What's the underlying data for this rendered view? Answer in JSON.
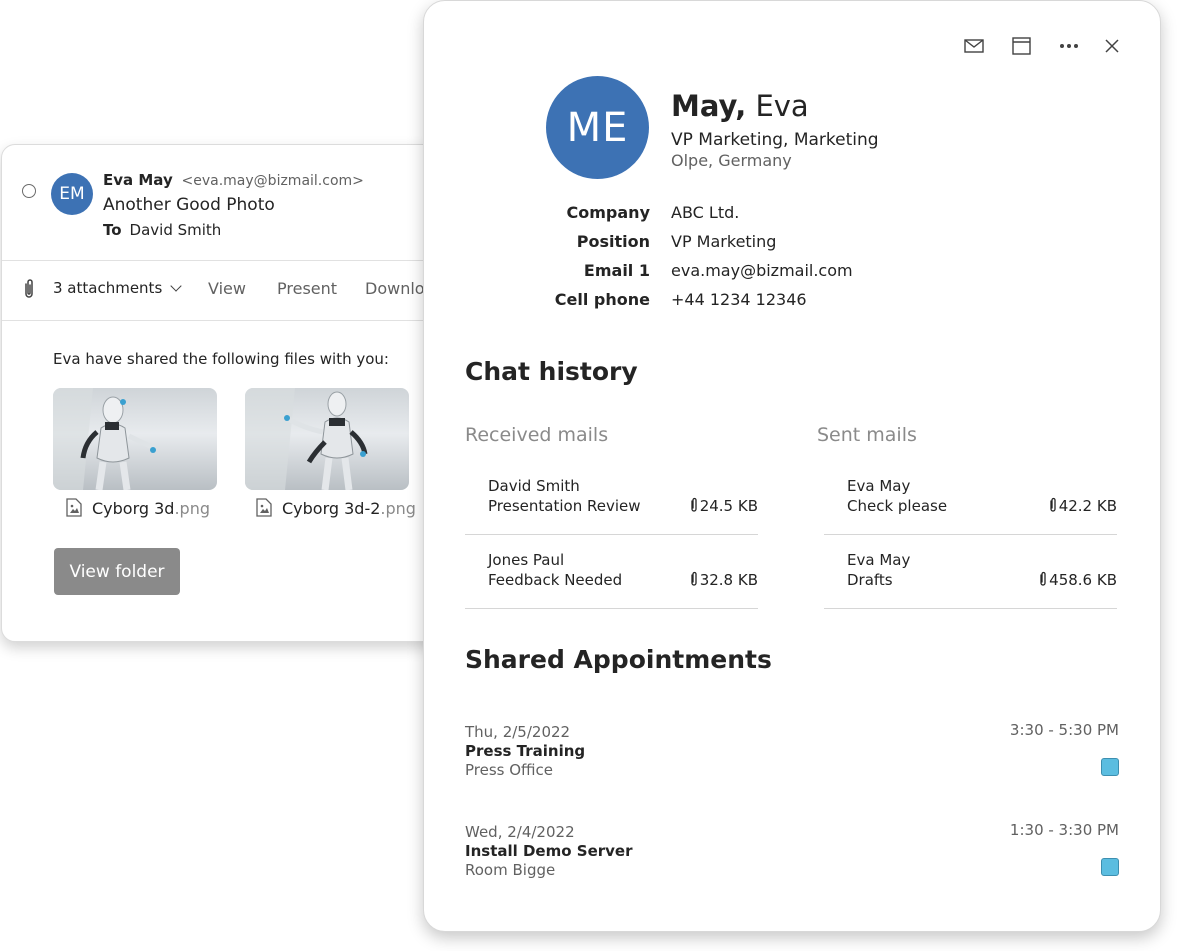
{
  "email": {
    "avatar_initials": "EM",
    "avatar_color": "#3d72b4",
    "sender_name": "Eva May",
    "sender_email": "<eva.may@bizmail.com>",
    "subject": "Another Good Photo",
    "to_label": "To",
    "to_value": "David Smith",
    "attachments_label": "3 attachments",
    "actions": {
      "view": "View",
      "present": "Present",
      "download": "Downlo"
    },
    "shared_message": "Eva have shared the following files with you:",
    "files": [
      {
        "name": "Cyborg 3d",
        "ext": ".png"
      },
      {
        "name": "Cyborg 3d-2",
        "ext": ".png"
      }
    ],
    "view_folder_label": "View folder"
  },
  "contact": {
    "toolbar": {
      "mail_icon": "mail-icon",
      "calendar_icon": "calendar-icon",
      "more_icon": "more-icon",
      "close_icon": "close-icon"
    },
    "avatar_initials": "ME",
    "avatar_color": "#3d72b4",
    "last_name": "May,",
    "first_name": "Eva",
    "title": "VP Marketing, Marketing",
    "location": "Olpe, Germany",
    "details": [
      {
        "label": "Company",
        "value": "ABC Ltd."
      },
      {
        "label": "Position",
        "value": "VP Marketing"
      },
      {
        "label": "Email 1",
        "value": "eva.may@bizmail.com"
      },
      {
        "label": "Cell phone",
        "value": "+44 1234 12346"
      }
    ],
    "chat_history_title": "Chat history",
    "received_title": "Received mails",
    "sent_title": "Sent mails",
    "received": [
      {
        "from": "David Smith",
        "subject": "Presentation Review",
        "size": "24.5 KB"
      },
      {
        "from": "Jones Paul",
        "subject": "Feedback Needed",
        "size": "32.8 KB"
      }
    ],
    "sent": [
      {
        "from": "Eva May",
        "subject": "Check please",
        "size": "42.2 KB"
      },
      {
        "from": "Eva May",
        "subject": "Drafts",
        "size": "458.6 KB"
      }
    ],
    "appointments_title": "Shared Appointments",
    "appointments": [
      {
        "date": "Thu, 2/5/2022",
        "title": "Press Training",
        "location": "Press Office",
        "time": "3:30 - 5:30 PM",
        "category_color": "#5bbde0"
      },
      {
        "date": "Wed, 2/4/2022",
        "title": "Install Demo Server",
        "location": "Room Bigge",
        "time": "1:30 - 3:30 PM",
        "category_color": "#5bbde0"
      }
    ]
  }
}
